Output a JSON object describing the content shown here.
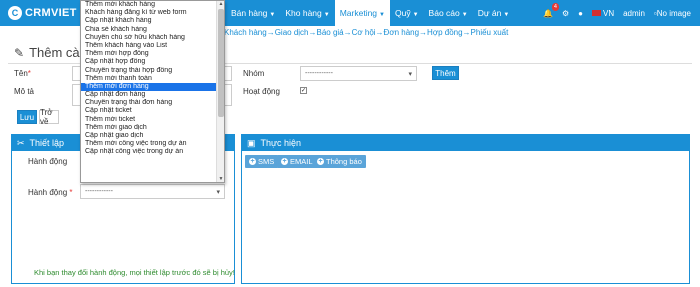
{
  "app": {
    "logo_text": "CRMVIET",
    "logo_mark": "C"
  },
  "nav": {
    "items": [
      {
        "label": "Bán hàng",
        "active": false
      },
      {
        "label": "Kho hàng",
        "active": false
      },
      {
        "label": "Marketing",
        "active": true
      },
      {
        "label": "Quỹ",
        "active": false
      },
      {
        "label": "Báo cáo",
        "active": false
      },
      {
        "label": "Dự án",
        "active": false
      }
    ],
    "notification_count": "4",
    "language": "VN",
    "user": "admin",
    "avatar_alt": "No image"
  },
  "breadcrumb": "Khách hàng→Giao dịch→Báo giá→Cơ hội→Đơn hàng→Hợp đồng→Phiếu xuất",
  "page": {
    "title": "Thêm cài đ"
  },
  "form": {
    "name_label": "Tên",
    "required_mark": "*",
    "desc_label": "Mô tả",
    "group_label": "Nhóm",
    "group_value": "------------",
    "add_button": "Thêm",
    "active_label": "Hoạt động",
    "active_checked": true,
    "save_button": "Lưu",
    "back_button": "Trở về"
  },
  "setup_panel": {
    "title": "Thiết lập",
    "action_label": "Hành động",
    "action2_label": "Hành động",
    "action_select_value": "------------",
    "warning": "Khi bạn thay đổi hành động, mọi thiết lập trước đó sẽ bị hủy!"
  },
  "execute_panel": {
    "title": "Thực hiện",
    "buttons": [
      "SMS",
      "EMAIL",
      "Thông báo"
    ]
  },
  "dropdown": {
    "items": [
      "Thêm mới khách hàng",
      "Khách hàng đăng kí từ web form",
      "Cập nhật khách hàng",
      "Chia sẻ khách hàng",
      "Chuyển chủ sở hữu khách hàng",
      "Thêm khách hàng vào List",
      "Thêm mới hợp đồng",
      "Cập nhật hợp đồng",
      "Chuyển trạng thái hợp đồng",
      "Thêm mới thanh toán",
      "Thêm mới đơn hàng",
      "Cập nhật đơn hàng",
      "Chuyển trạng thái đơn hàng",
      "Cập nhật ticket",
      "Thêm mới ticket",
      "Thêm mới giao dịch",
      "Cập nhật giao dịch",
      "Thêm mới công việc trong dự án",
      "Cập nhật công việc trong dự án"
    ],
    "selected_index": 10
  },
  "colors": {
    "brand": "#1a8fd5",
    "selected": "#1a73e8",
    "warning_text": "#2e8b2e"
  }
}
